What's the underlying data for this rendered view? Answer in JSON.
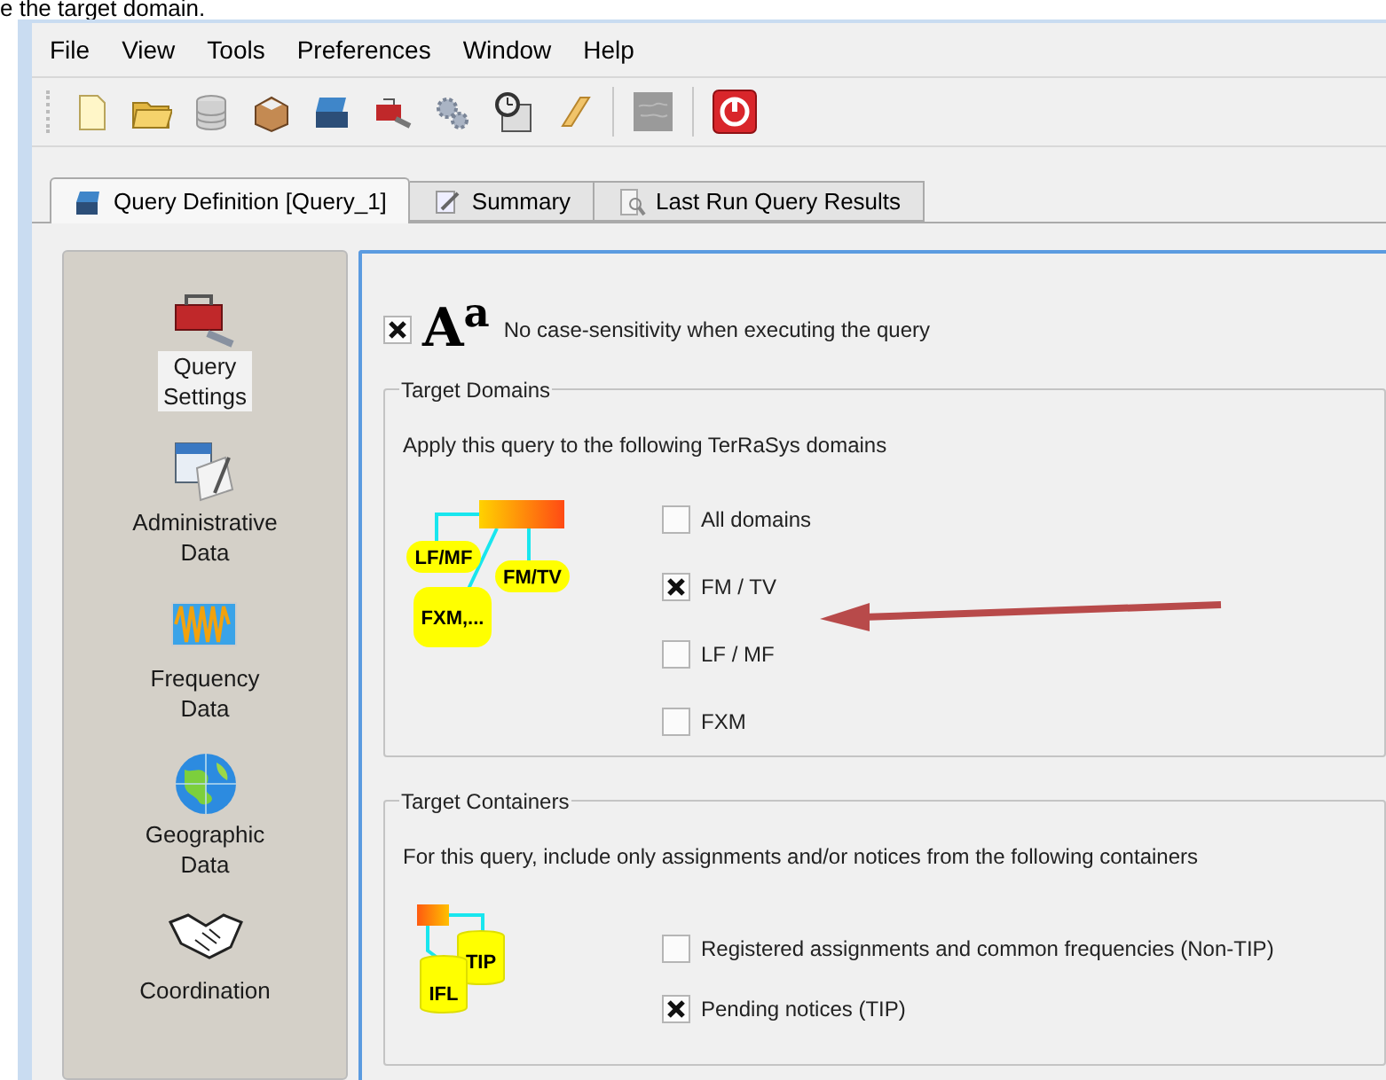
{
  "caption": "e the target domain.",
  "menu": [
    "File",
    "View",
    "Tools",
    "Preferences",
    "Window",
    "Help"
  ],
  "tabs": [
    {
      "label": "Query Definition [Query_1]",
      "selected": true
    },
    {
      "label": "Summary",
      "selected": false
    },
    {
      "label": "Last Run Query Results",
      "selected": false
    }
  ],
  "sidebar": {
    "items": [
      {
        "label": "Query Settings",
        "selected": true
      },
      {
        "label": "Administrative Data",
        "selected": false
      },
      {
        "label": "Frequency Data",
        "selected": false
      },
      {
        "label": "Geographic Data",
        "selected": false
      },
      {
        "label": "Coordination",
        "selected": false
      }
    ]
  },
  "case_option": {
    "glyph": "A$^{a}$",
    "label": "No case-sensitivity when executing the query",
    "checked": true
  },
  "target_domains": {
    "title": "Target Domains",
    "description": "Apply this query to the following TerRaSys domains",
    "diagram_labels": [
      "LF/MF",
      "FM/TV",
      "FXM,..."
    ],
    "options": [
      {
        "label": "All domains",
        "checked": false
      },
      {
        "label": "FM / TV",
        "checked": true
      },
      {
        "label": "LF / MF",
        "checked": false
      },
      {
        "label": "FXM",
        "checked": false
      }
    ]
  },
  "target_containers": {
    "title": "Target Containers",
    "description": "For this query, include only assignments and/or notices from the following containers",
    "diagram_labels": [
      "TIP",
      "IFL"
    ],
    "options": [
      {
        "label": "Registered assignments and common frequencies (Non-TIP)",
        "checked": false
      },
      {
        "label": "Pending notices (TIP)",
        "checked": true
      }
    ]
  }
}
